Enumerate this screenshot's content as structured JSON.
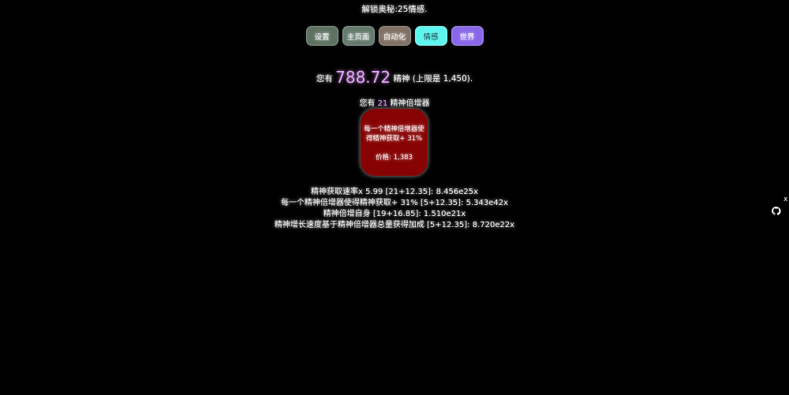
{
  "unlock_text": "解锁奥秘:25情感.",
  "tabs": [
    {
      "label": "设置",
      "color": "#5f7262"
    },
    {
      "label": "主页面",
      "color": "#647a6c"
    },
    {
      "label": "自动化",
      "color": "#817064"
    },
    {
      "label": "情感",
      "color": "#5ff5ef"
    },
    {
      "label": "世界",
      "color": "#8a67e8"
    }
  ],
  "spirit": {
    "prefix": "您有",
    "amount": "788.72",
    "suffix": "精神 (上限是 1,450)."
  },
  "multiplier": {
    "prefix": "您有",
    "count": "21",
    "suffix": "精神倍增器"
  },
  "buy_card": {
    "description": "每一个精神倍增器使得精神获取+ 31%",
    "price": "价格: 1,383",
    "color": "#870303"
  },
  "stats": [
    "精神获取速率x 5.99 [21+12.35]: 8.456e25x",
    "每一个精神倍增器使得精神获取+ 31% [5+12.35]: 5.343e42x",
    "精神倍增自身 [19+16.85]: 1.510e21x",
    "精神增长速度基于精神倍增器总量获得加成 [5+12.35]: 8.720e22x"
  ],
  "side": {
    "close_label": "x",
    "icon": "github-cat-icon"
  },
  "colors": {
    "background": "#000000",
    "highlight": "#e8a6ff"
  }
}
